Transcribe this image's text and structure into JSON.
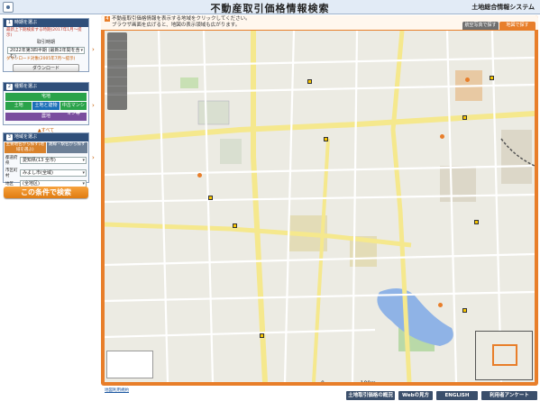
{
  "header": {
    "title": "不動産取引価格情報検索",
    "system_name": "土地総合情報システム"
  },
  "sidebar": {
    "step1": {
      "number": "1",
      "title": "時期を選ぶ",
      "note": "最新上下期検索する時期(2017年1月〜提示)",
      "period_label": "取引時期",
      "period_value": "2022年第3四半期 (最新2年間を含む)",
      "download_note": "ダウンロード対象(2005年7月〜提示)",
      "download_button": "ダウンロード"
    },
    "step2": {
      "number": "2",
      "title": "種類を選ぶ",
      "types": [
        "宅地",
        "土地",
        "土地と建物",
        "中古マンション等",
        "農地",
        "林地"
      ],
      "selected": "土地と建物",
      "collapse": "▲すべて"
    },
    "step3": {
      "number": "3",
      "title": "地域を選ぶ",
      "tabs": [
        "主要地名から探す(地域を選ぶ)",
        "路線・駅名から探す"
      ],
      "fields": [
        {
          "label": "都道府県",
          "value": "愛知県(13 全市)"
        },
        {
          "label": "市区町村",
          "value": "みよし市(全域)"
        },
        {
          "label": "地区",
          "value": "(全地区)"
        }
      ],
      "map_button": "上記の地域を表示する"
    },
    "search_button": "この条件で検索"
  },
  "map": {
    "instructions_line1": "不動産取引価格情報を表示する地域をクリックしてください。",
    "instructions_line2": "ブラウザ画面を広げると、地図の表示領域も広がります。",
    "btn_aerial": "航空写真で探す",
    "btn_map": "地図で探す",
    "scale_left": "0",
    "scale_right": "100m",
    "labels": [],
    "price_labels": [],
    "green_labels": [],
    "shops": [],
    "legend_lines": [],
    "copyright": ""
  },
  "footer": {
    "link": "地図利用規約",
    "nav": [
      "土地取引価格の概況",
      "Webの見方",
      "ENGLISH",
      "利用者アンケート"
    ]
  }
}
